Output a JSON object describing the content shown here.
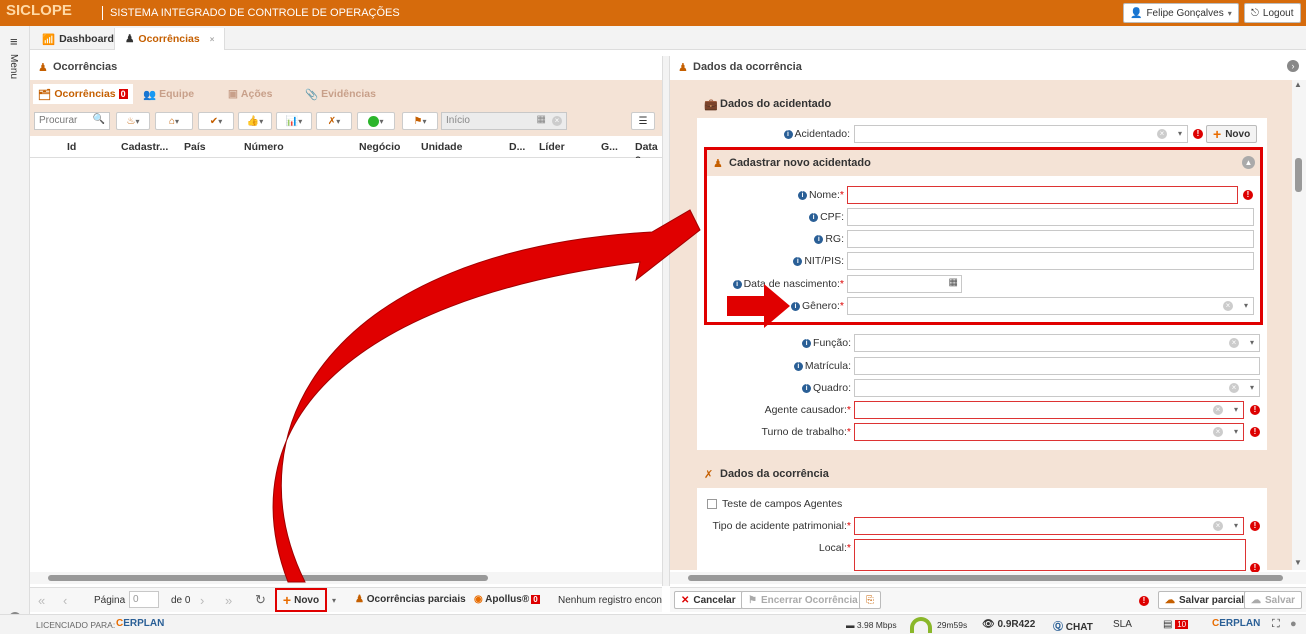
{
  "app": {
    "logo": "SICLOPE",
    "system_title": "SISTEMA INTEGRADO DE CONTROLE DE OPERAÇÕES",
    "user": "Felipe Gonçalves",
    "logout": "Logout",
    "menu": "Menu"
  },
  "main_tabs": [
    {
      "label": "Dashboard"
    },
    {
      "label": "Ocorrências"
    }
  ],
  "left": {
    "title": "Ocorrências",
    "subtabs": [
      {
        "label": "Ocorrências",
        "badge": "0"
      },
      {
        "label": "Equipe"
      },
      {
        "label": "Ações"
      },
      {
        "label": "Evidências"
      }
    ],
    "search_placeholder": "Procurar",
    "date_placeholder": "Início",
    "columns": [
      "Id",
      "Cadastr...",
      "País",
      "Número",
      "Negócio",
      "Unidade",
      "D...",
      "Líder",
      "G...",
      "Data c"
    ],
    "pager": {
      "page_label": "Página",
      "page_value": "0",
      "of_label": "de 0"
    },
    "buttons": {
      "novo": "Novo",
      "parciais": "Ocorrências parciais",
      "apollus": "Apollus®",
      "apollus_badge": "0"
    },
    "no_records": "Nenhum registro encontra"
  },
  "right": {
    "title": "Dados da ocorrência",
    "section1": "Dados do acidentado",
    "acidentado_label": "Acidentado:",
    "novo_label": "Novo",
    "cadastro_title": "Cadastrar novo acidentado",
    "cadastro_fields": [
      "Nome:",
      "CPF:",
      "RG:",
      "NIT/PIS:",
      "Data de nascimento:",
      "Gênero:"
    ],
    "fields2": [
      "Função:",
      "Matrícula:",
      "Quadro:",
      "Agente causador:",
      "Turno de trabalho:"
    ],
    "section2": "Dados da ocorrência",
    "checkbox_label": "Teste de campos Agentes",
    "tipo_label": "Tipo de acidente patrimonial:",
    "local_label": "Local:",
    "buttons": {
      "cancelar": "Cancelar",
      "encerrar": "Encerrar Ocorrência",
      "salvar_parcial": "Salvar parcial",
      "salvar": "Salvar"
    }
  },
  "footer": {
    "licensed": "LICENCIADO PARA:",
    "brand": "ERPLAN",
    "speed": "3.98 Mbps",
    "time": "29m59s",
    "version": "0.9R422",
    "chat": "CHAT",
    "sla": "SLA",
    "sla_badge": "10"
  },
  "colors": {
    "orange": "#d66b0c",
    "arrow": "#e00000"
  }
}
